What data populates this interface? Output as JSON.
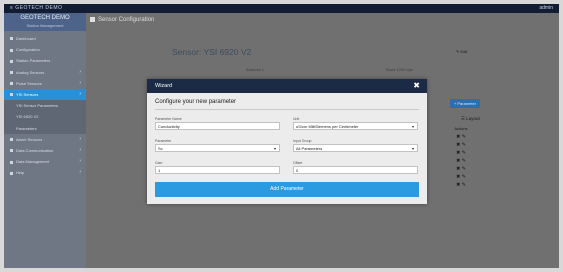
{
  "topbar": {
    "logo": "≡ GEOTECH DEMO",
    "user": "admin"
  },
  "brand": {
    "title": "GEOTECH DEMO",
    "subtitle": "Station Management"
  },
  "nav": {
    "items": [
      {
        "label": "Dashboard",
        "arrow": ""
      },
      {
        "label": "Configuration",
        "arrow": ""
      },
      {
        "label": "Station Parameters",
        "arrow": ""
      },
      {
        "label": "Analog Sensors",
        "arrow": "›"
      },
      {
        "label": "Pulse Sensors",
        "arrow": "›"
      },
      {
        "label": "YSI Sensors",
        "arrow": "›"
      },
      {
        "label": "YSI Sensor Parameters",
        "arrow": ""
      },
      {
        "label": "YSI 6920 V2",
        "arrow": ""
      },
      {
        "label": "Parameters",
        "arrow": ""
      },
      {
        "label": "Alarm Sensors",
        "arrow": "›"
      },
      {
        "label": "Data Communication",
        "arrow": "›"
      },
      {
        "label": "Data Management",
        "arrow": "›"
      },
      {
        "label": "Help",
        "arrow": "›"
      }
    ]
  },
  "breadcrumb": {
    "label": "Sensor Configuration"
  },
  "sensor": {
    "prefix": "Sensor:",
    "name": "YSI 6920 V2",
    "edit": "✎ Edit",
    "sub1": "Address 1",
    "sub2": "Baud 1200 bps"
  },
  "actions": {
    "param_button": "+ Parameter",
    "list_label": "☰ Layout",
    "header": "Actions",
    "row_icons": "✖ ✎",
    "row_count": 7
  },
  "modal": {
    "title": "Wizard",
    "close": "✖",
    "heading": "Configure your new parameter",
    "fields": [
      {
        "label": "Parameter Name",
        "value": "Conductivity",
        "caret": ""
      },
      {
        "label": "Unit",
        "value": "uS/cm  MilliSiemens per Centimeter",
        "caret": "▾"
      },
      {
        "label": "Parameter",
        "value": "Sc",
        "caret": "▾"
      },
      {
        "label": "Input Group",
        "value": "All Parameters",
        "caret": "▾"
      },
      {
        "label": "Gain",
        "value": "1",
        "caret": ""
      },
      {
        "label": "Offset",
        "value": "0",
        "caret": ""
      }
    ],
    "add_button": "Add Parameter"
  }
}
